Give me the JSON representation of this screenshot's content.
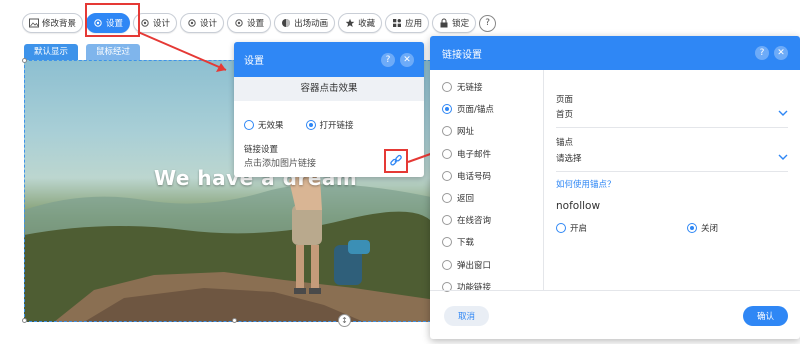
{
  "toolbar": {
    "items": [
      {
        "label": "修改背景",
        "icon": "image-icon"
      },
      {
        "label": "设置",
        "icon": "gear-icon",
        "active": true
      },
      {
        "label": "设计",
        "icon": "gear-icon"
      },
      {
        "label": "设计",
        "icon": "gear-icon"
      },
      {
        "label": "设置",
        "icon": "gear-icon"
      },
      {
        "label": "出场动画",
        "icon": "animation-icon"
      },
      {
        "label": "收藏",
        "icon": "star-icon"
      },
      {
        "label": "应用",
        "icon": "apps-icon"
      },
      {
        "label": "锁定",
        "icon": "lock-icon"
      }
    ],
    "help": "?"
  },
  "image_tabs": {
    "default": "默认显示",
    "hover": "鼠标经过"
  },
  "hero": {
    "title": "We have a dream"
  },
  "settings_panel": {
    "title": "设置",
    "subtitle": "容器点击效果",
    "options": [
      "无效果",
      "打开链接"
    ],
    "selected": "打开链接",
    "link_label": "链接设置",
    "link_hint": "点击添加图片链接"
  },
  "link_panel": {
    "title": "链接设置",
    "options": [
      "无链接",
      "页面/锚点",
      "网址",
      "电子邮件",
      "电话号码",
      "返回",
      "在线咨询",
      "下载",
      "弹出窗口",
      "功能链接"
    ],
    "selected": "页面/锚点",
    "page_label": "页面",
    "page_value": "首页",
    "anchor_label": "锚点",
    "anchor_value": "请选择",
    "anchor_help": "如何使用锚点？",
    "nofollow_label": "nofollow",
    "nofollow_options": [
      "开启",
      "关闭"
    ],
    "nofollow_selected": "关闭",
    "cancel": "取消",
    "confirm": "确认"
  },
  "colors": {
    "accent": "#2f87f5",
    "highlight": "#e53935"
  }
}
